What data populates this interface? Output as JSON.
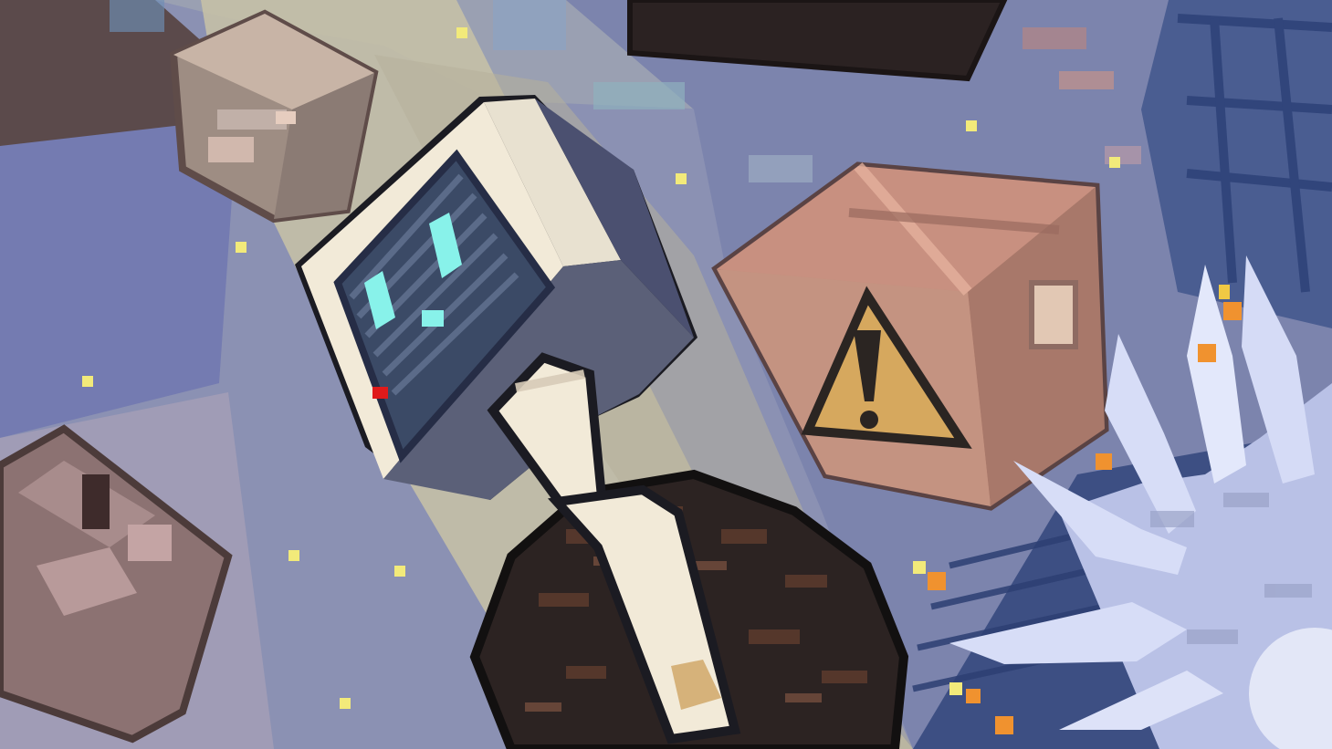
{
  "scene": {
    "kind": "illustration",
    "elements": [
      "crt-monitor-robot",
      "warning-cardboard-box",
      "cardboard-box-top-left",
      "cardboard-box-left",
      "dark-box-top",
      "hairy-dark-creature",
      "white-spiky-creature",
      "glowing-particles"
    ]
  },
  "palette": {
    "background_blue": "#7f86ab",
    "background_light": "#b9b7a0",
    "city_dark_blue": "#374a7f",
    "monitor_cream": "#f2ead8",
    "monitor_dark": "#4b5070",
    "screen_dark": "#3b4a66",
    "screen_eye": "#88f2ea",
    "warning_yellow": "#d6a85e",
    "cardboard": "#c7927d",
    "cardboard_dark": "#9b6a5f",
    "hair_dark": "#2f2524",
    "hair_brown": "#5a3a2d",
    "spike_light": "#d7ddf7",
    "spike_shadow": "#9aa3c8",
    "particle_yellow": "#f2ea7a",
    "particle_orange": "#f0922f",
    "indicator_red": "#e01a1a"
  }
}
